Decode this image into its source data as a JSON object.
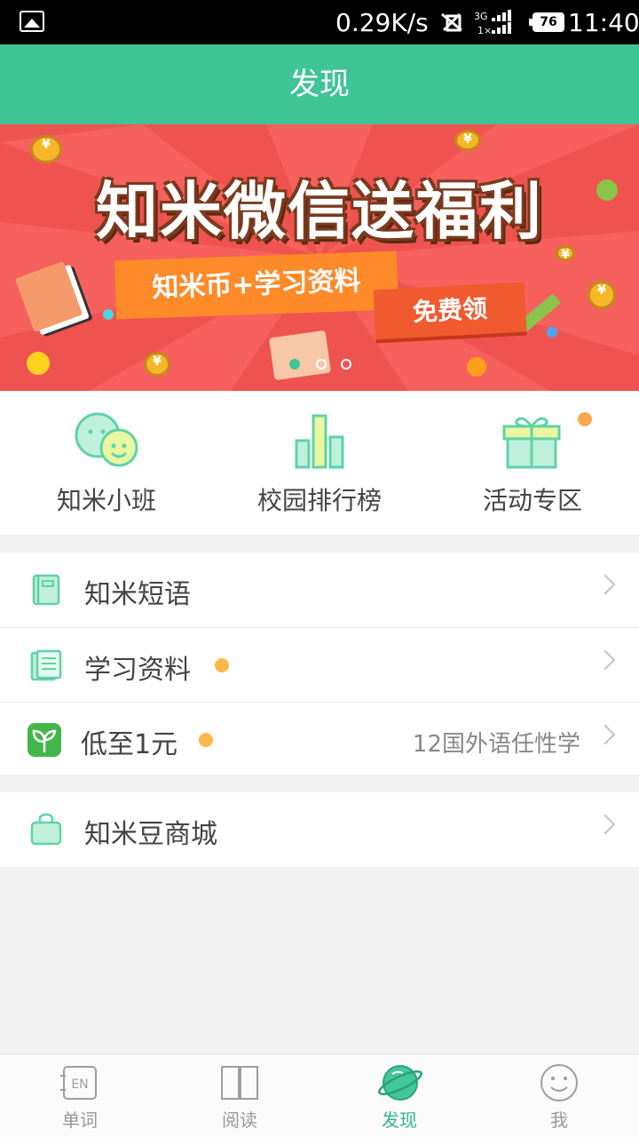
{
  "status_bar": {
    "speed": "0.29K/s",
    "network": "3G",
    "sim": "1×",
    "battery": "76",
    "time": "11:40"
  },
  "header": {
    "title": "发现"
  },
  "banner": {
    "headline": "知米微信送福利",
    "ribbon": "知米币+学习资料",
    "cta": "免费领",
    "slides": 3,
    "active_slide": 1
  },
  "shortcuts": [
    {
      "label": "知米小班",
      "icon": "smile-faces-icon"
    },
    {
      "label": "校园排行榜",
      "icon": "bar-chart-icon"
    },
    {
      "label": "活动专区",
      "icon": "gift-icon",
      "has_badge": true
    }
  ],
  "list_group_1": [
    {
      "label": "知米短语",
      "icon": "notebook-icon",
      "dot": false,
      "sub": ""
    },
    {
      "label": "学习资料",
      "icon": "document-icon",
      "dot": true,
      "sub": ""
    },
    {
      "label": "低至1元",
      "icon": "sprout-icon",
      "dot": true,
      "sub": "12国外语任性学"
    }
  ],
  "list_group_2": [
    {
      "label": "知米豆商城",
      "icon": "shopping-bag-icon"
    }
  ],
  "bottom_nav": [
    {
      "label": "单词",
      "icon": "en-book-icon",
      "active": false
    },
    {
      "label": "阅读",
      "icon": "open-book-icon",
      "active": false
    },
    {
      "label": "发现",
      "icon": "planet-icon",
      "active": true
    },
    {
      "label": "我",
      "icon": "smiley-icon",
      "active": false
    }
  ],
  "colors": {
    "accent": "#3fc495",
    "banner_red": "#ef5350",
    "dot_orange": "#ffa94d",
    "icon_mint": "#5fd3a6"
  }
}
